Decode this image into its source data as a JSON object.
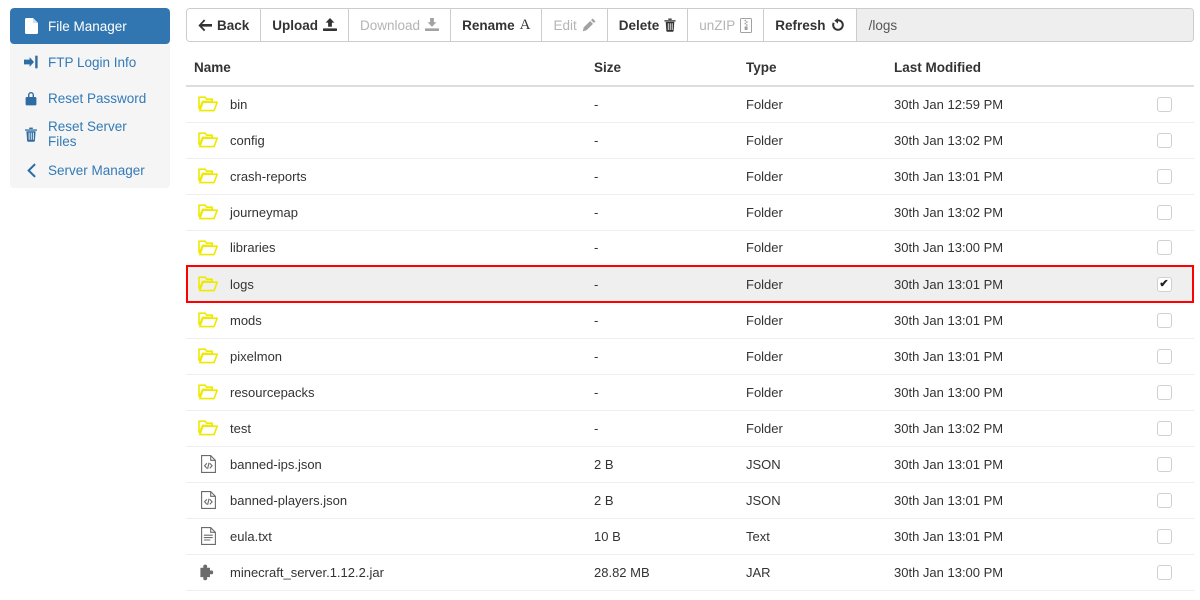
{
  "sidebar": {
    "items": [
      {
        "label": "File Manager",
        "icon": "file-icon",
        "active": true
      },
      {
        "label": "FTP Login Info",
        "icon": "sign-in-icon",
        "active": false
      },
      {
        "label": "Reset Password",
        "icon": "lock-icon",
        "active": false
      },
      {
        "label": "Reset Server Files",
        "icon": "trash-icon",
        "active": false
      },
      {
        "label": "Server Manager",
        "icon": "chevron-left-icon",
        "active": false
      }
    ]
  },
  "toolbar": {
    "buttons": [
      {
        "label": "Back",
        "icon": "arrow-left-icon",
        "disabled": false
      },
      {
        "label": "Upload",
        "icon": "upload-icon",
        "disabled": false
      },
      {
        "label": "Download",
        "icon": "download-icon",
        "disabled": true
      },
      {
        "label": "Rename",
        "icon": "font-a-icon",
        "disabled": false
      },
      {
        "label": "Edit",
        "icon": "pencil-icon",
        "disabled": true
      },
      {
        "label": "Delete",
        "icon": "trash-icon",
        "disabled": false
      },
      {
        "label": "unZIP",
        "icon": "file-archive-icon",
        "disabled": true
      },
      {
        "label": "Refresh",
        "icon": "refresh-icon",
        "disabled": false
      }
    ],
    "path": "/logs"
  },
  "table": {
    "headers": {
      "name": "Name",
      "size": "Size",
      "type": "Type",
      "modified": "Last Modified"
    },
    "rows": [
      {
        "name": "bin",
        "size": "-",
        "type": "Folder",
        "modified": "30th Jan 12:59 PM",
        "icon": "folder-icon",
        "checked": false,
        "selected": false
      },
      {
        "name": "config",
        "size": "-",
        "type": "Folder",
        "modified": "30th Jan 13:02 PM",
        "icon": "folder-icon",
        "checked": false,
        "selected": false
      },
      {
        "name": "crash-reports",
        "size": "-",
        "type": "Folder",
        "modified": "30th Jan 13:01 PM",
        "icon": "folder-icon",
        "checked": false,
        "selected": false
      },
      {
        "name": "journeymap",
        "size": "-",
        "type": "Folder",
        "modified": "30th Jan 13:02 PM",
        "icon": "folder-icon",
        "checked": false,
        "selected": false
      },
      {
        "name": "libraries",
        "size": "-",
        "type": "Folder",
        "modified": "30th Jan 13:00 PM",
        "icon": "folder-icon",
        "checked": false,
        "selected": false
      },
      {
        "name": "logs",
        "size": "-",
        "type": "Folder",
        "modified": "30th Jan 13:01 PM",
        "icon": "folder-icon",
        "checked": true,
        "selected": true
      },
      {
        "name": "mods",
        "size": "-",
        "type": "Folder",
        "modified": "30th Jan 13:01 PM",
        "icon": "folder-icon",
        "checked": false,
        "selected": false
      },
      {
        "name": "pixelmon",
        "size": "-",
        "type": "Folder",
        "modified": "30th Jan 13:01 PM",
        "icon": "folder-icon",
        "checked": false,
        "selected": false
      },
      {
        "name": "resourcepacks",
        "size": "-",
        "type": "Folder",
        "modified": "30th Jan 13:00 PM",
        "icon": "folder-icon",
        "checked": false,
        "selected": false
      },
      {
        "name": "test",
        "size": "-",
        "type": "Folder",
        "modified": "30th Jan 13:02 PM",
        "icon": "folder-icon",
        "checked": false,
        "selected": false
      },
      {
        "name": "banned-ips.json",
        "size": "2 B",
        "type": "JSON",
        "modified": "30th Jan 13:01 PM",
        "icon": "file-code-icon",
        "checked": false,
        "selected": false
      },
      {
        "name": "banned-players.json",
        "size": "2 B",
        "type": "JSON",
        "modified": "30th Jan 13:01 PM",
        "icon": "file-code-icon",
        "checked": false,
        "selected": false
      },
      {
        "name": "eula.txt",
        "size": "10 B",
        "type": "Text",
        "modified": "30th Jan 13:01 PM",
        "icon": "file-text-icon",
        "checked": false,
        "selected": false
      },
      {
        "name": "minecraft_server.1.12.2.jar",
        "size": "28.82 MB",
        "type": "JAR",
        "modified": "30th Jan 13:00 PM",
        "icon": "puzzle-piece-icon",
        "checked": false,
        "selected": false
      }
    ]
  },
  "colors": {
    "accent_blue": "#3276b1",
    "link_blue": "#337ab7",
    "folder_yellow": "#edea00",
    "selection_red": "#ff0000",
    "row_selected_bg": "#efefef"
  }
}
